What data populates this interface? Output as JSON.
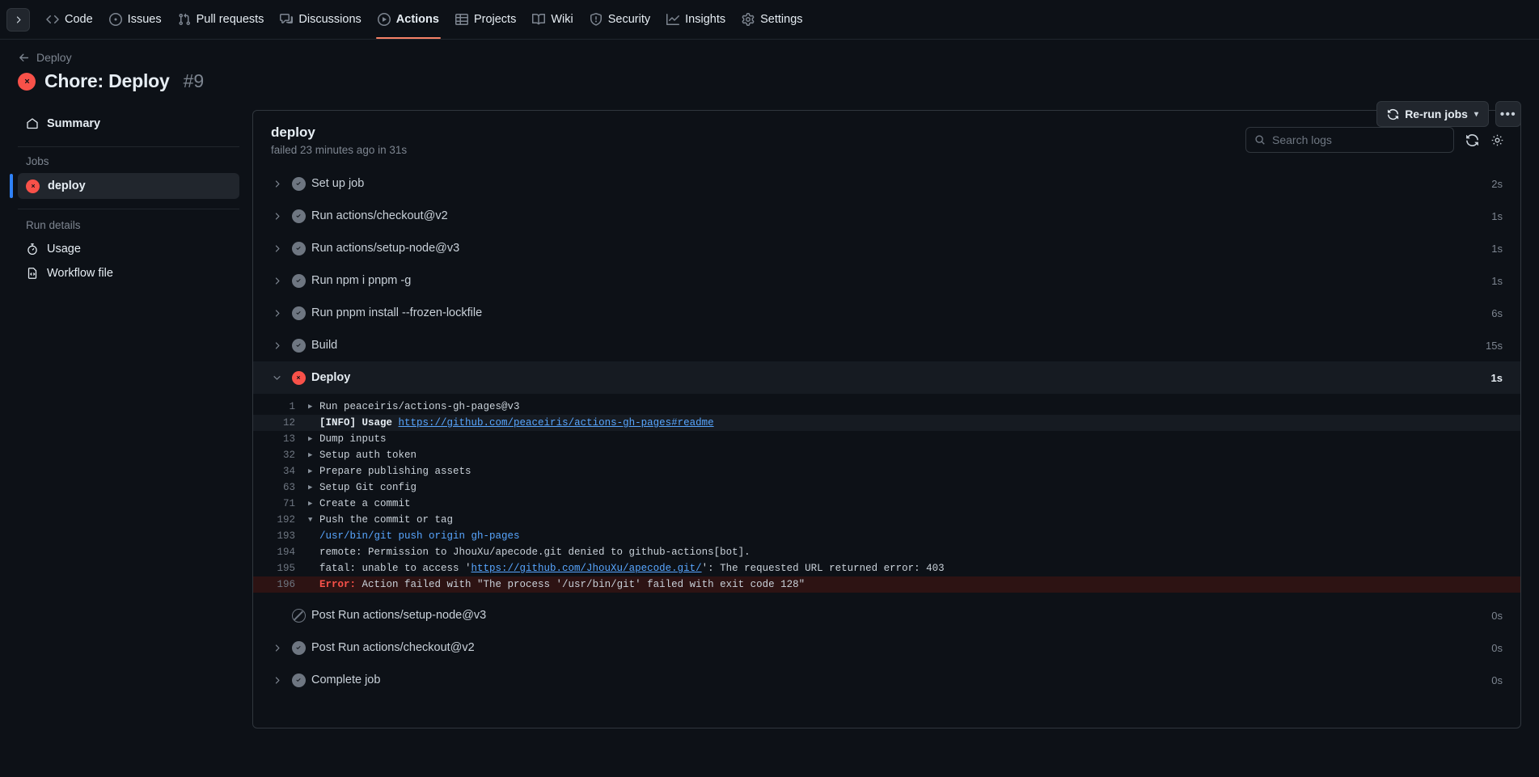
{
  "repo_nav": {
    "expand_icon": "chevron-right-icon",
    "items": [
      {
        "label": "Code",
        "icon": "code-icon",
        "active": false
      },
      {
        "label": "Issues",
        "icon": "issue-opened-icon",
        "active": false
      },
      {
        "label": "Pull requests",
        "icon": "git-pull-request-icon",
        "active": false
      },
      {
        "label": "Discussions",
        "icon": "comment-discussion-icon",
        "active": false
      },
      {
        "label": "Actions",
        "icon": "play-icon",
        "active": true
      },
      {
        "label": "Projects",
        "icon": "table-icon",
        "active": false
      },
      {
        "label": "Wiki",
        "icon": "book-icon",
        "active": false
      },
      {
        "label": "Security",
        "icon": "shield-icon",
        "active": false
      },
      {
        "label": "Insights",
        "icon": "graph-icon",
        "active": false
      },
      {
        "label": "Settings",
        "icon": "gear-icon",
        "active": false
      }
    ]
  },
  "run_header": {
    "back_label": "Deploy",
    "back_icon": "arrow-left-icon",
    "status_icon": "x-circle-fill-icon",
    "status_color": "#f85149",
    "title": "Chore: Deploy",
    "run_number": "#9",
    "rerun_label": "Re-run jobs",
    "rerun_icon": "sync-icon",
    "rerun_chevron": "▾",
    "more_label": "•••"
  },
  "sidebar": {
    "summary": {
      "label": "Summary",
      "icon": "home-icon"
    },
    "jobs_heading": "Jobs",
    "jobs": [
      {
        "label": "deploy",
        "status": "failure",
        "icon": "x-circle-fill-icon",
        "selected": true
      }
    ],
    "run_details_heading": "Run details",
    "run_details": [
      {
        "label": "Usage",
        "icon": "stopwatch-icon"
      },
      {
        "label": "Workflow file",
        "icon": "file-code-icon"
      }
    ]
  },
  "panel": {
    "title": "deploy",
    "subtitle": "failed 23 minutes ago in 31s",
    "search": {
      "placeholder": "Search logs",
      "value": "",
      "icon": "search-icon"
    },
    "refresh_icon": "sync-icon",
    "settings_icon": "gear-icon"
  },
  "steps": [
    {
      "name": "Set up job",
      "status": "success",
      "duration": "2s",
      "expanded": false,
      "has_caret": true
    },
    {
      "name": "Run actions/checkout@v2",
      "status": "success",
      "duration": "1s",
      "expanded": false,
      "has_caret": true
    },
    {
      "name": "Run actions/setup-node@v3",
      "status": "success",
      "duration": "1s",
      "expanded": false,
      "has_caret": true
    },
    {
      "name": "Run npm i pnpm -g",
      "status": "success",
      "duration": "1s",
      "expanded": false,
      "has_caret": true
    },
    {
      "name": "Run pnpm install --frozen-lockfile",
      "status": "success",
      "duration": "6s",
      "expanded": false,
      "has_caret": true
    },
    {
      "name": "Build",
      "status": "success",
      "duration": "15s",
      "expanded": false,
      "has_caret": true
    },
    {
      "name": "Deploy",
      "status": "failure",
      "duration": "1s",
      "expanded": true,
      "has_caret": true
    }
  ],
  "steps_after": [
    {
      "name": "Post Run actions/setup-node@v3",
      "status": "skipped",
      "duration": "0s",
      "expanded": false,
      "has_caret": false
    },
    {
      "name": "Post Run actions/checkout@v2",
      "status": "success",
      "duration": "0s",
      "expanded": false,
      "has_caret": true
    },
    {
      "name": "Complete job",
      "status": "success",
      "duration": "0s",
      "expanded": false,
      "has_caret": true
    }
  ],
  "log_lines": [
    {
      "num": "1",
      "marker": "collapsed",
      "style": "plain",
      "text": "Run peaceiris/actions-gh-pages@v3"
    },
    {
      "num": "12",
      "marker": "none",
      "style": "highlighted",
      "prefix": "[INFO] Usage ",
      "link": "https://github.com/peaceiris/actions-gh-pages#readme",
      "text": "[INFO] Usage https://github.com/peaceiris/actions-gh-pages#readme"
    },
    {
      "num": "13",
      "marker": "collapsed",
      "style": "plain",
      "text": "Dump inputs"
    },
    {
      "num": "32",
      "marker": "collapsed",
      "style": "plain",
      "text": "Setup auth token"
    },
    {
      "num": "34",
      "marker": "collapsed",
      "style": "plain",
      "text": "Prepare publishing assets"
    },
    {
      "num": "63",
      "marker": "collapsed",
      "style": "plain",
      "text": "Setup Git config"
    },
    {
      "num": "71",
      "marker": "collapsed",
      "style": "plain",
      "text": "Create a commit"
    },
    {
      "num": "192",
      "marker": "expanded",
      "style": "plain",
      "text": "Push the commit or tag"
    },
    {
      "num": "193",
      "marker": "none",
      "style": "blue",
      "text": "/usr/bin/git push origin gh-pages"
    },
    {
      "num": "194",
      "marker": "none",
      "style": "plain",
      "text": "remote: Permission to JhouXu/apecode.git denied to github-actions[bot]."
    },
    {
      "num": "195",
      "marker": "none",
      "style": "link-inline",
      "pre": "fatal: unable to access '",
      "link": "https://github.com/JhouXu/apecode.git/",
      "post": "': The requested URL returned error: 403",
      "text": "fatal: unable to access 'https://github.com/JhouXu/apecode.git/': The requested URL returned error: 403"
    },
    {
      "num": "196",
      "marker": "none",
      "style": "error",
      "error_label": "Error:",
      "error_rest": " Action failed with \"The process '/usr/bin/git' failed with exit code 128\"",
      "text": "Error: Action failed with \"The process '/usr/bin/git' failed with exit code 128\""
    }
  ],
  "colors": {
    "page_bg": "#0d1117",
    "accent_underline": "#f78166",
    "failure": "#f85149",
    "link": "#58a6ff",
    "selected_bar": "#2f81f7",
    "error_row_bg": "#2d1313"
  }
}
